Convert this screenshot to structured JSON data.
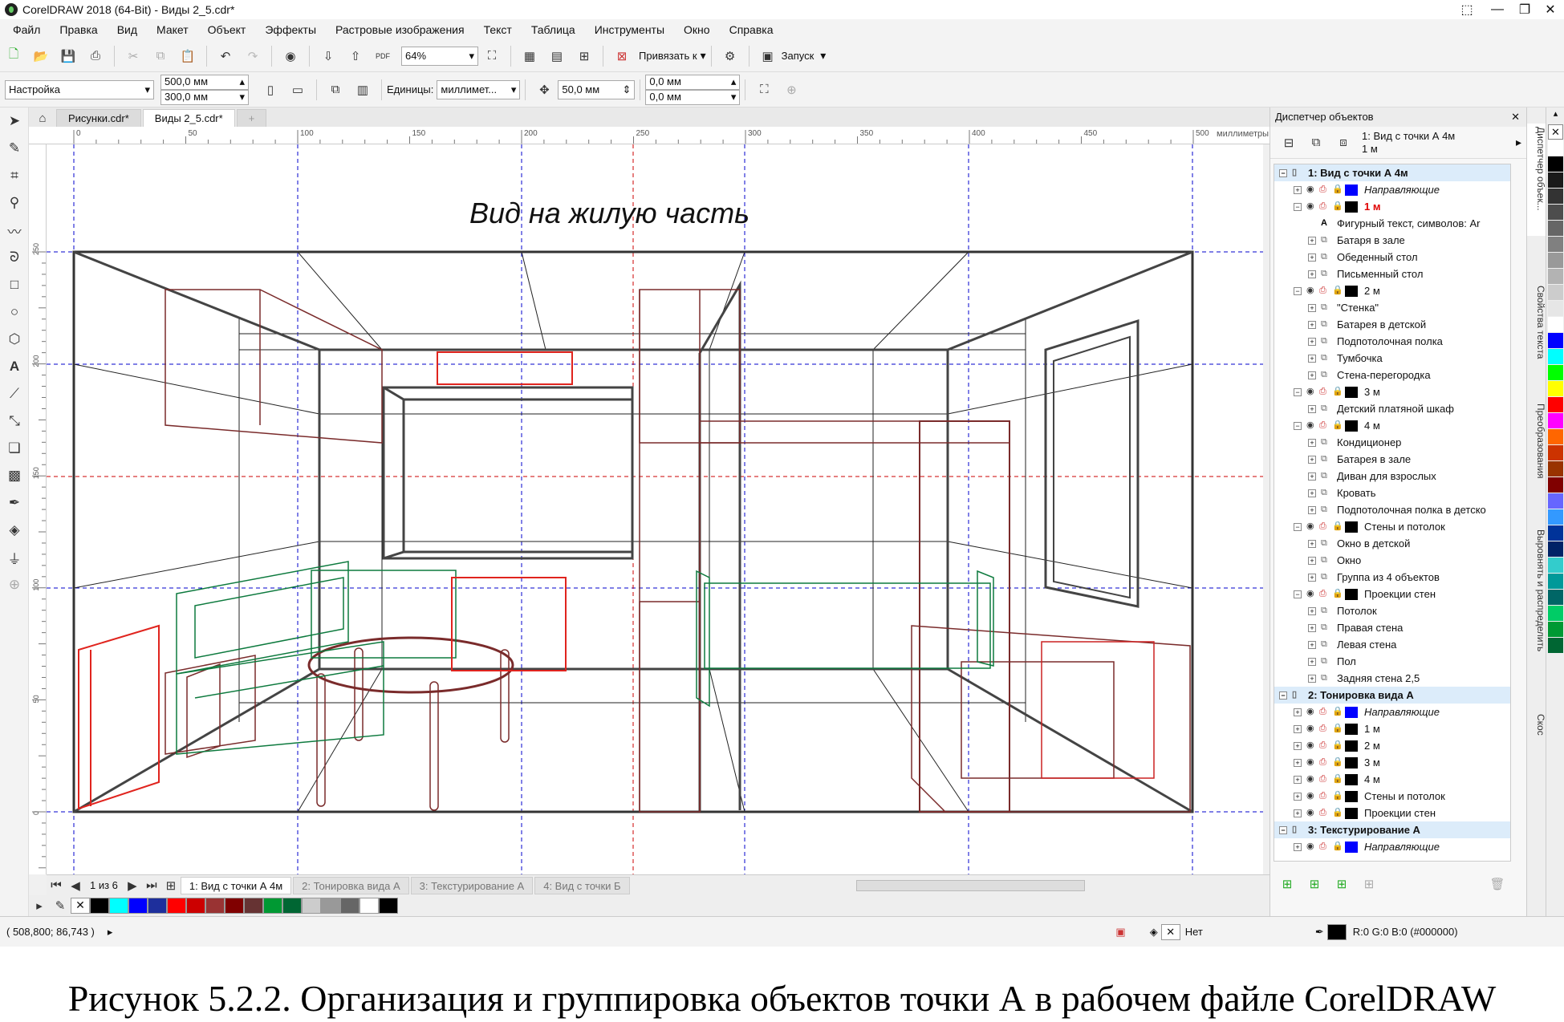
{
  "window": {
    "title": "CorelDRAW 2018 (64-Bit) - Виды 2_5.cdr*"
  },
  "menu": [
    "Файл",
    "Правка",
    "Вид",
    "Макет",
    "Объект",
    "Эффекты",
    "Растровые изображения",
    "Текст",
    "Таблица",
    "Инструменты",
    "Окно",
    "Справка"
  ],
  "toolbar1": {
    "zoom": "64%",
    "snap_label": "Привязать к",
    "launch_label": "Запуск",
    "pdf_label": "PDF"
  },
  "toolbar2": {
    "preset": "Настройка",
    "width": "500,0 мм",
    "height": "300,0 мм",
    "units_label": "Единицы:",
    "units_value": "миллимет...",
    "nudge": "50,0 мм",
    "dup_x": "0,0 мм",
    "dup_y": "0,0 мм"
  },
  "doc_tabs": [
    "Рисунки.cdr*",
    "Виды 2_5.cdr*"
  ],
  "ruler": {
    "h_ticks": [
      "0",
      "50",
      "100",
      "150",
      "200",
      "250",
      "300",
      "350",
      "400",
      "450",
      "500"
    ],
    "units": "миллиметры",
    "v_ticks": [
      "250",
      "200",
      "150",
      "100",
      "50",
      "0"
    ]
  },
  "canvas": {
    "title_text": "Вид на жилую часть"
  },
  "page_nav": {
    "counter": "1 из 6",
    "pages": [
      "1: Вид с точки А 4м",
      "2: Тонировка вида А",
      "3: Текстурирование А",
      "4: Вид с точки Б"
    ]
  },
  "status": {
    "coords": "( 508,800; 86,743 )",
    "fill_none": "Нет",
    "color_value": "R:0 G:0 B:0 (#000000)"
  },
  "docker": {
    "title": "Диспетчер объектов",
    "current": "1: Вид с точки А 4м",
    "current_layer": "1 м",
    "tree": [
      {
        "level": 0,
        "type": "page",
        "label": "1: Вид с точки А 4м",
        "ex": "−"
      },
      {
        "level": 1,
        "type": "layer",
        "label": "Направляющие",
        "color": "#0000ff",
        "style": "italic",
        "ex": "+"
      },
      {
        "level": 1,
        "type": "layer",
        "label": "1 м",
        "color": "#000000",
        "style": "red",
        "ex": "−"
      },
      {
        "level": 2,
        "type": "text",
        "label": "Фигурный текст, символов: Ar"
      },
      {
        "level": 2,
        "type": "obj",
        "label": "Батаря в зале",
        "ex": "+"
      },
      {
        "level": 2,
        "type": "obj",
        "label": "Обеденный стол",
        "ex": "+"
      },
      {
        "level": 2,
        "type": "obj",
        "label": "Письменный стол",
        "ex": "+"
      },
      {
        "level": 1,
        "type": "layer",
        "label": "2 м",
        "color": "#000000",
        "ex": "−"
      },
      {
        "level": 2,
        "type": "obj",
        "label": "\"Стенка\"",
        "ex": "+"
      },
      {
        "level": 2,
        "type": "obj",
        "label": "Батарея в детской",
        "ex": "+"
      },
      {
        "level": 2,
        "type": "obj",
        "label": "Подпотолочная полка",
        "ex": "+"
      },
      {
        "level": 2,
        "type": "obj",
        "label": "Тумбочка",
        "ex": "+"
      },
      {
        "level": 2,
        "type": "obj",
        "label": "Стена-перегородка",
        "ex": "+"
      },
      {
        "level": 1,
        "type": "layer",
        "label": "3 м",
        "color": "#000000",
        "ex": "−"
      },
      {
        "level": 2,
        "type": "obj",
        "label": "Детский платяной шкаф",
        "ex": "+"
      },
      {
        "level": 1,
        "type": "layer",
        "label": "4 м",
        "color": "#000000",
        "ex": "−"
      },
      {
        "level": 2,
        "type": "obj",
        "label": "Кондиционер",
        "ex": "+"
      },
      {
        "level": 2,
        "type": "obj",
        "label": "Батарея в зале",
        "ex": "+"
      },
      {
        "level": 2,
        "type": "obj",
        "label": "Диван для взрослых",
        "ex": "+"
      },
      {
        "level": 2,
        "type": "obj",
        "label": "Кровать",
        "ex": "+"
      },
      {
        "level": 2,
        "type": "obj",
        "label": "Подпотолочная полка в детско",
        "ex": "+"
      },
      {
        "level": 1,
        "type": "layer",
        "label": "Стены и потолок",
        "color": "#000000",
        "ex": "−"
      },
      {
        "level": 2,
        "type": "obj",
        "label": "Окно в детской",
        "ex": "+"
      },
      {
        "level": 2,
        "type": "obj",
        "label": "Окно",
        "ex": "+"
      },
      {
        "level": 2,
        "type": "obj",
        "label": "Группа из 4 объектов",
        "ex": "+"
      },
      {
        "level": 1,
        "type": "layer",
        "label": "Проекции стен",
        "color": "#000000",
        "ex": "−"
      },
      {
        "level": 2,
        "type": "obj",
        "label": "Потолок",
        "ex": "+"
      },
      {
        "level": 2,
        "type": "obj",
        "label": "Правая стена",
        "ex": "+"
      },
      {
        "level": 2,
        "type": "obj",
        "label": "Левая стена",
        "ex": "+"
      },
      {
        "level": 2,
        "type": "obj",
        "label": "Пол",
        "ex": "+"
      },
      {
        "level": 2,
        "type": "obj",
        "label": "Задняя стена 2,5",
        "ex": "+"
      },
      {
        "level": 0,
        "type": "page",
        "label": "2: Тонировка вида А",
        "ex": "−"
      },
      {
        "level": 1,
        "type": "layer",
        "label": "Направляющие",
        "color": "#0000ff",
        "style": "italic",
        "ex": "+"
      },
      {
        "level": 1,
        "type": "layer",
        "label": "1 м",
        "color": "#000000",
        "ex": "+"
      },
      {
        "level": 1,
        "type": "layer",
        "label": "2 м",
        "color": "#000000",
        "ex": "+"
      },
      {
        "level": 1,
        "type": "layer",
        "label": "3 м",
        "color": "#000000",
        "ex": "+"
      },
      {
        "level": 1,
        "type": "layer",
        "label": "4 м",
        "color": "#000000",
        "ex": "+"
      },
      {
        "level": 1,
        "type": "layer",
        "label": "Стены и потолок",
        "color": "#000000",
        "ex": "+"
      },
      {
        "level": 1,
        "type": "layer",
        "label": "Проекции стен",
        "color": "#000000",
        "ex": "+"
      },
      {
        "level": 0,
        "type": "page",
        "label": "3: Текстурирование А",
        "ex": "−"
      },
      {
        "level": 1,
        "type": "layer",
        "label": "Направляющие",
        "color": "#0000ff",
        "style": "italic",
        "ex": "+"
      }
    ]
  },
  "side_tabs": [
    "Диспетчер объек...",
    "Свойства текста",
    "Преобразования",
    "Выровнять и распределить",
    "Скос"
  ],
  "palette": [
    "#ffffff",
    "#000000",
    "#1a1a1a",
    "#333333",
    "#4d4d4d",
    "#666666",
    "#808080",
    "#999999",
    "#b3b3b3",
    "#cccccc",
    "#e6e6e6",
    "#ffffff",
    "#0000ff",
    "#00ffff",
    "#00ff00",
    "#ffff00",
    "#ff0000",
    "#ff00ff",
    "#ff6600",
    "#cc3300",
    "#993300",
    "#800000",
    "#6666ff",
    "#3399ff",
    "#003399",
    "#002266",
    "#33cccc",
    "#009999",
    "#006666",
    "#00cc66",
    "#009933",
    "#006633"
  ],
  "bottom_swatches": [
    "#000000",
    "#00ffff",
    "#0000ff",
    "#1e2f9c",
    "#ff0000",
    "#cc0000",
    "#993333",
    "#800000",
    "#663333",
    "#009933",
    "#006633",
    "#cccccc",
    "#999999",
    "#666666",
    "#ffffff",
    "#000000"
  ],
  "caption": "Рисунок 5.2.2. Организация и группировка объектов точки А в рабочем файле CorelDRAW"
}
